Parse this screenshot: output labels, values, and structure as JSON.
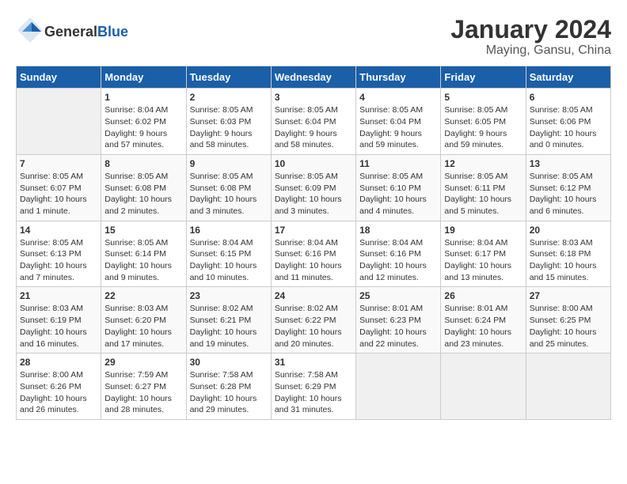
{
  "logo": {
    "general": "General",
    "blue": "Blue"
  },
  "title": "January 2024",
  "subtitle": "Maying, Gansu, China",
  "days_header": [
    "Sunday",
    "Monday",
    "Tuesday",
    "Wednesday",
    "Thursday",
    "Friday",
    "Saturday"
  ],
  "weeks": [
    [
      {
        "num": "",
        "info": ""
      },
      {
        "num": "1",
        "info": "Sunrise: 8:04 AM\nSunset: 6:02 PM\nDaylight: 9 hours\nand 57 minutes."
      },
      {
        "num": "2",
        "info": "Sunrise: 8:05 AM\nSunset: 6:03 PM\nDaylight: 9 hours\nand 58 minutes."
      },
      {
        "num": "3",
        "info": "Sunrise: 8:05 AM\nSunset: 6:04 PM\nDaylight: 9 hours\nand 58 minutes."
      },
      {
        "num": "4",
        "info": "Sunrise: 8:05 AM\nSunset: 6:04 PM\nDaylight: 9 hours\nand 59 minutes."
      },
      {
        "num": "5",
        "info": "Sunrise: 8:05 AM\nSunset: 6:05 PM\nDaylight: 9 hours\nand 59 minutes."
      },
      {
        "num": "6",
        "info": "Sunrise: 8:05 AM\nSunset: 6:06 PM\nDaylight: 10 hours\nand 0 minutes."
      }
    ],
    [
      {
        "num": "7",
        "info": "Sunrise: 8:05 AM\nSunset: 6:07 PM\nDaylight: 10 hours\nand 1 minute."
      },
      {
        "num": "8",
        "info": "Sunrise: 8:05 AM\nSunset: 6:08 PM\nDaylight: 10 hours\nand 2 minutes."
      },
      {
        "num": "9",
        "info": "Sunrise: 8:05 AM\nSunset: 6:08 PM\nDaylight: 10 hours\nand 3 minutes."
      },
      {
        "num": "10",
        "info": "Sunrise: 8:05 AM\nSunset: 6:09 PM\nDaylight: 10 hours\nand 3 minutes."
      },
      {
        "num": "11",
        "info": "Sunrise: 8:05 AM\nSunset: 6:10 PM\nDaylight: 10 hours\nand 4 minutes."
      },
      {
        "num": "12",
        "info": "Sunrise: 8:05 AM\nSunset: 6:11 PM\nDaylight: 10 hours\nand 5 minutes."
      },
      {
        "num": "13",
        "info": "Sunrise: 8:05 AM\nSunset: 6:12 PM\nDaylight: 10 hours\nand 6 minutes."
      }
    ],
    [
      {
        "num": "14",
        "info": "Sunrise: 8:05 AM\nSunset: 6:13 PM\nDaylight: 10 hours\nand 7 minutes."
      },
      {
        "num": "15",
        "info": "Sunrise: 8:05 AM\nSunset: 6:14 PM\nDaylight: 10 hours\nand 9 minutes."
      },
      {
        "num": "16",
        "info": "Sunrise: 8:04 AM\nSunset: 6:15 PM\nDaylight: 10 hours\nand 10 minutes."
      },
      {
        "num": "17",
        "info": "Sunrise: 8:04 AM\nSunset: 6:16 PM\nDaylight: 10 hours\nand 11 minutes."
      },
      {
        "num": "18",
        "info": "Sunrise: 8:04 AM\nSunset: 6:16 PM\nDaylight: 10 hours\nand 12 minutes."
      },
      {
        "num": "19",
        "info": "Sunrise: 8:04 AM\nSunset: 6:17 PM\nDaylight: 10 hours\nand 13 minutes."
      },
      {
        "num": "20",
        "info": "Sunrise: 8:03 AM\nSunset: 6:18 PM\nDaylight: 10 hours\nand 15 minutes."
      }
    ],
    [
      {
        "num": "21",
        "info": "Sunrise: 8:03 AM\nSunset: 6:19 PM\nDaylight: 10 hours\nand 16 minutes."
      },
      {
        "num": "22",
        "info": "Sunrise: 8:03 AM\nSunset: 6:20 PM\nDaylight: 10 hours\nand 17 minutes."
      },
      {
        "num": "23",
        "info": "Sunrise: 8:02 AM\nSunset: 6:21 PM\nDaylight: 10 hours\nand 19 minutes."
      },
      {
        "num": "24",
        "info": "Sunrise: 8:02 AM\nSunset: 6:22 PM\nDaylight: 10 hours\nand 20 minutes."
      },
      {
        "num": "25",
        "info": "Sunrise: 8:01 AM\nSunset: 6:23 PM\nDaylight: 10 hours\nand 22 minutes."
      },
      {
        "num": "26",
        "info": "Sunrise: 8:01 AM\nSunset: 6:24 PM\nDaylight: 10 hours\nand 23 minutes."
      },
      {
        "num": "27",
        "info": "Sunrise: 8:00 AM\nSunset: 6:25 PM\nDaylight: 10 hours\nand 25 minutes."
      }
    ],
    [
      {
        "num": "28",
        "info": "Sunrise: 8:00 AM\nSunset: 6:26 PM\nDaylight: 10 hours\nand 26 minutes."
      },
      {
        "num": "29",
        "info": "Sunrise: 7:59 AM\nSunset: 6:27 PM\nDaylight: 10 hours\nand 28 minutes."
      },
      {
        "num": "30",
        "info": "Sunrise: 7:58 AM\nSunset: 6:28 PM\nDaylight: 10 hours\nand 29 minutes."
      },
      {
        "num": "31",
        "info": "Sunrise: 7:58 AM\nSunset: 6:29 PM\nDaylight: 10 hours\nand 31 minutes."
      },
      {
        "num": "",
        "info": ""
      },
      {
        "num": "",
        "info": ""
      },
      {
        "num": "",
        "info": ""
      }
    ]
  ]
}
